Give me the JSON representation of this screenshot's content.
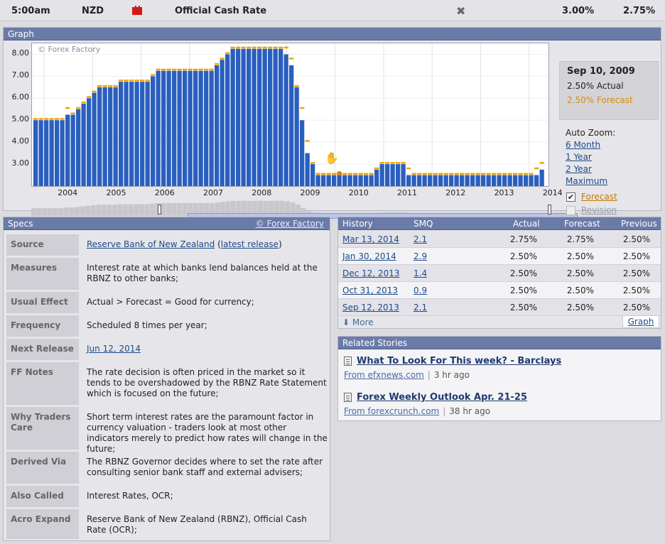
{
  "event": {
    "time": "5:00am",
    "currency": "NZD",
    "impact_icon": "red-folder-icon",
    "impact_color": "#d21818",
    "title": "Official Cash Rate",
    "close_glyph": "✖",
    "actual": "3.00%",
    "previous": "2.75%"
  },
  "graph": {
    "header": "Graph",
    "watermark": "© Forex Factory",
    "yticks": [
      "8.00",
      "7.00",
      "6.00",
      "5.00",
      "4.00",
      "3.00"
    ],
    "xticks": [
      "2004",
      "2005",
      "2006",
      "2007",
      "2008",
      "2009",
      "2010",
      "2011",
      "2012",
      "2013",
      "2014"
    ],
    "info": {
      "date": "Sep 10, 2009",
      "actual": "2.50% Actual",
      "forecast": "2.50% Forecast"
    },
    "auto_zoom_label": "Auto Zoom:",
    "zoom_options": [
      "6 Month",
      "1 Year",
      "2 Year",
      "Maximum"
    ],
    "toggles": {
      "forecast": {
        "label": "Forecast",
        "checked": true
      },
      "revision": {
        "label": "Revision",
        "checked": false
      }
    },
    "colors": {
      "bar": "#2a5fc0",
      "forecast": "#f0a500",
      "highlight": "#e08a00"
    }
  },
  "chart_data": {
    "type": "bar",
    "ylim": [
      2.0,
      8.5
    ],
    "xlim": [
      2003.75,
      2014.4
    ],
    "yticks": [
      3,
      4,
      5,
      6,
      7,
      8
    ],
    "xticks": [
      2004,
      2005,
      2006,
      2007,
      2008,
      2009,
      2010,
      2011,
      2012,
      2013,
      2014
    ],
    "grid": true,
    "highlighted": {
      "date": "Sep 10, 2009",
      "actual": 2.5,
      "forecast": 2.5
    },
    "series": [
      {
        "name": "Actual",
        "values": [
          5.0,
          5.0,
          5.0,
          5.0,
          5.0,
          5.0,
          5.25,
          5.25,
          5.5,
          5.75,
          6.0,
          6.25,
          6.5,
          6.5,
          6.5,
          6.5,
          6.75,
          6.75,
          6.75,
          6.75,
          6.75,
          6.75,
          7.0,
          7.25,
          7.25,
          7.25,
          7.25,
          7.25,
          7.25,
          7.25,
          7.25,
          7.25,
          7.25,
          7.25,
          7.5,
          7.75,
          8.0,
          8.25,
          8.25,
          8.25,
          8.25,
          8.25,
          8.25,
          8.25,
          8.25,
          8.25,
          8.25,
          8.0,
          7.5,
          6.5,
          5.0,
          3.5,
          3.0,
          2.5,
          2.5,
          2.5,
          2.5,
          2.5,
          2.5,
          2.5,
          2.5,
          2.5,
          2.5,
          2.5,
          2.75,
          3.0,
          3.0,
          3.0,
          3.0,
          3.0,
          2.5,
          2.5,
          2.5,
          2.5,
          2.5,
          2.5,
          2.5,
          2.5,
          2.5,
          2.5,
          2.5,
          2.5,
          2.5,
          2.5,
          2.5,
          2.5,
          2.5,
          2.5,
          2.5,
          2.5,
          2.5,
          2.5,
          2.5,
          2.5,
          2.5,
          2.75
        ]
      },
      {
        "name": "Forecast",
        "values": [
          5.0,
          5.0,
          5.0,
          5.0,
          5.0,
          5.0,
          5.5,
          5.25,
          5.5,
          5.75,
          6.0,
          6.25,
          6.5,
          6.5,
          6.5,
          6.5,
          6.75,
          6.75,
          6.75,
          6.75,
          6.75,
          6.75,
          7.0,
          7.25,
          7.25,
          7.25,
          7.25,
          7.25,
          7.25,
          7.25,
          7.25,
          7.25,
          7.25,
          7.25,
          7.5,
          7.75,
          8.0,
          8.25,
          8.25,
          8.25,
          8.25,
          8.25,
          8.25,
          8.25,
          8.25,
          8.25,
          8.25,
          8.25,
          7.75,
          6.5,
          5.5,
          4.0,
          3.0,
          2.5,
          2.5,
          2.5,
          2.5,
          2.5,
          2.5,
          2.5,
          2.5,
          2.5,
          2.5,
          2.5,
          2.75,
          3.0,
          3.0,
          3.0,
          3.0,
          3.0,
          2.75,
          2.5,
          2.5,
          2.5,
          2.5,
          2.5,
          2.5,
          2.5,
          2.5,
          2.5,
          2.5,
          2.5,
          2.5,
          2.5,
          2.5,
          2.5,
          2.5,
          2.5,
          2.5,
          2.5,
          2.5,
          2.5,
          2.5,
          2.5,
          2.75,
          3.0
        ]
      }
    ]
  },
  "specs": {
    "header": "Specs",
    "copyright": "© Forex Factory",
    "rows": [
      {
        "label": "Source",
        "value": "",
        "source_link": "Reserve Bank of New Zealand",
        "paren_open": " (",
        "release_link": "latest release",
        "paren_close": ")"
      },
      {
        "label": "Measures",
        "value": "Interest rate at which banks lend balances held at the RBNZ to other banks;"
      },
      {
        "label": "Usual Effect",
        "value": "Actual > Forecast = Good for currency;"
      },
      {
        "label": "Frequency",
        "value": "Scheduled 8 times per year;"
      },
      {
        "label": "Next Release",
        "value": "Jun 12, 2014"
      },
      {
        "label": "FF Notes",
        "value": "The rate decision is often priced in the market so it tends to be overshadowed by the RBNZ Rate Statement which is focused on the future;"
      },
      {
        "label": "Why Traders Care",
        "value": "Short term interest rates are the paramount factor in currency valuation - traders look at most other indicators merely to predict how rates will change in the future;"
      },
      {
        "label": "Derived Via",
        "value": "The RBNZ Governor decides where to set the rate after consulting senior bank staff and external advisers;"
      },
      {
        "label": "Also Called",
        "value": "Interest Rates, OCR;"
      },
      {
        "label": "Acro Expand",
        "value": "Reserve Bank of New Zealand (RBNZ), Official Cash Rate (OCR);"
      }
    ]
  },
  "history": {
    "columns": [
      "History",
      "SMQ",
      "Actual",
      "Forecast",
      "Previous"
    ],
    "rows": [
      {
        "date": "Mar 13, 2014",
        "smq": "2.1",
        "actual": "2.75%",
        "forecast": "2.75%",
        "previous": "2.50%"
      },
      {
        "date": "Jan 30, 2014",
        "smq": "2.9",
        "actual": "2.50%",
        "forecast": "2.50%",
        "previous": "2.50%"
      },
      {
        "date": "Dec 12, 2013",
        "smq": "1.4",
        "actual": "2.50%",
        "forecast": "2.50%",
        "previous": "2.50%"
      },
      {
        "date": "Oct 31, 2013",
        "smq": "0.9",
        "actual": "2.50%",
        "forecast": "2.50%",
        "previous": "2.50%"
      },
      {
        "date": "Sep 12, 2013",
        "smq": "2.1",
        "actual": "2.50%",
        "forecast": "2.50%",
        "previous": "2.50%"
      }
    ],
    "more": "More",
    "graph_button": "Graph"
  },
  "stories": {
    "header": "Related Stories",
    "items": [
      {
        "title": "What To Look For This week? - Barclays",
        "source": "From efxnews.com",
        "age": "3 hr ago"
      },
      {
        "title": "Forex Weekly Outlook Apr. 21-25",
        "source": "From forexcrunch.com",
        "age": "38 hr ago"
      }
    ]
  }
}
